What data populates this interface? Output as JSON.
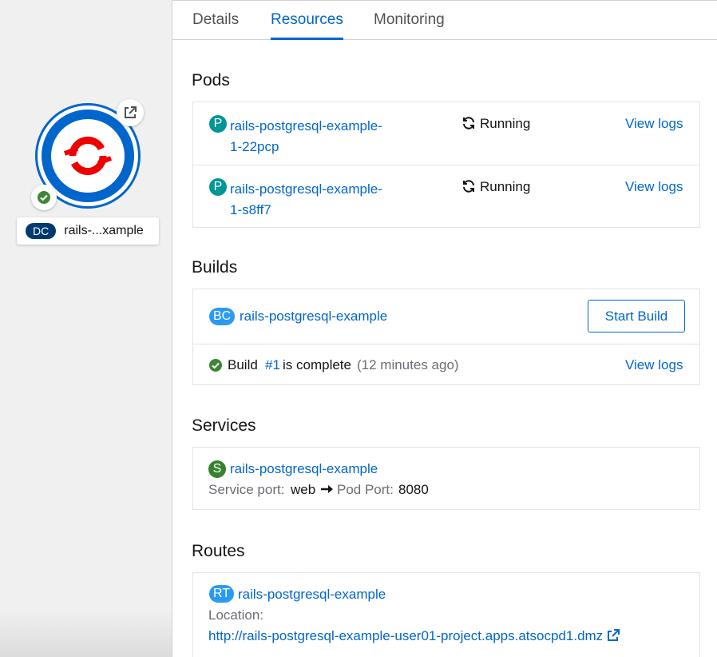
{
  "topology": {
    "node_kind": "DC",
    "node_label": "rails-...xample"
  },
  "tabs": [
    "Details",
    "Resources",
    "Monitoring"
  ],
  "pods": {
    "title": "Pods",
    "items": [
      {
        "badge": "P",
        "name_line1": "rails-postgresql-example-",
        "name_line2": "1-22pcp",
        "status": "Running",
        "action": "View logs"
      },
      {
        "badge": "P",
        "name_line1": "rails-postgresql-example-",
        "name_line2": "1-s8ff7",
        "status": "Running",
        "action": "View logs"
      }
    ]
  },
  "builds": {
    "title": "Builds",
    "config_badge": "BC",
    "config_name": "rails-postgresql-example",
    "start_label": "Start Build",
    "build_prefix": "Build",
    "build_number": "#1",
    "build_suffix": "is complete",
    "build_time": "(12 minutes ago)",
    "action": "View logs"
  },
  "services": {
    "title": "Services",
    "badge": "S",
    "name": "rails-postgresql-example",
    "service_port_label": "Service port:",
    "service_port": "web",
    "pod_port_label": "Pod Port:",
    "pod_port": "8080"
  },
  "routes": {
    "title": "Routes",
    "badge": "RT",
    "name": "rails-postgresql-example",
    "location_label": "Location:",
    "url": "http://rails-postgresql-example-user01-project.apps.atsocpd1.dmz"
  },
  "colors": {
    "link": "#0066cc",
    "success": "#3e8635",
    "openshift_red": "#ee0000"
  }
}
